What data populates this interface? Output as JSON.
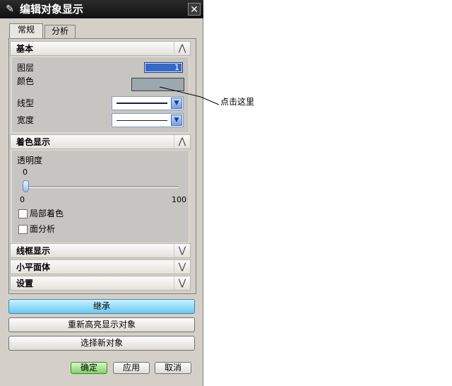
{
  "dialog": {
    "title": "编辑对象显示",
    "close_glyph": "✕",
    "title_icon": "pen-icon"
  },
  "tabs": [
    {
      "label": "常规",
      "active": true
    },
    {
      "label": "分析",
      "active": false
    }
  ],
  "basic": {
    "header": "基本",
    "layer_label": "图层",
    "layer_value": "1",
    "color_label": "颜色",
    "color_value": "#9ba8ad",
    "linetype_label": "线型",
    "width_label": "宽度"
  },
  "shading": {
    "header": "着色显示",
    "transparency_label": "透明度",
    "transparency_value": "0",
    "slider_min": "0",
    "slider_max": "100",
    "slider_fraction": 0,
    "partial_shading_label": "局部着色",
    "face_analysis_label": "面分析"
  },
  "collapsed_sections": {
    "wireframe": "线框显示",
    "facet_body": "小平面体",
    "settings": "设置"
  },
  "buttons": {
    "inherit": "继承",
    "reselect_highlight": "重新高亮显示对象",
    "select_new": "选择新对象",
    "ok": "确定",
    "apply": "应用",
    "cancel": "取消"
  },
  "annotation": {
    "hint": "点击这里"
  },
  "colors": {
    "titlebar": "#1a1a1a",
    "inherit_button": "#6cc8f2",
    "ok_button": "#7fd26a",
    "layer_field": "#3768c8"
  }
}
